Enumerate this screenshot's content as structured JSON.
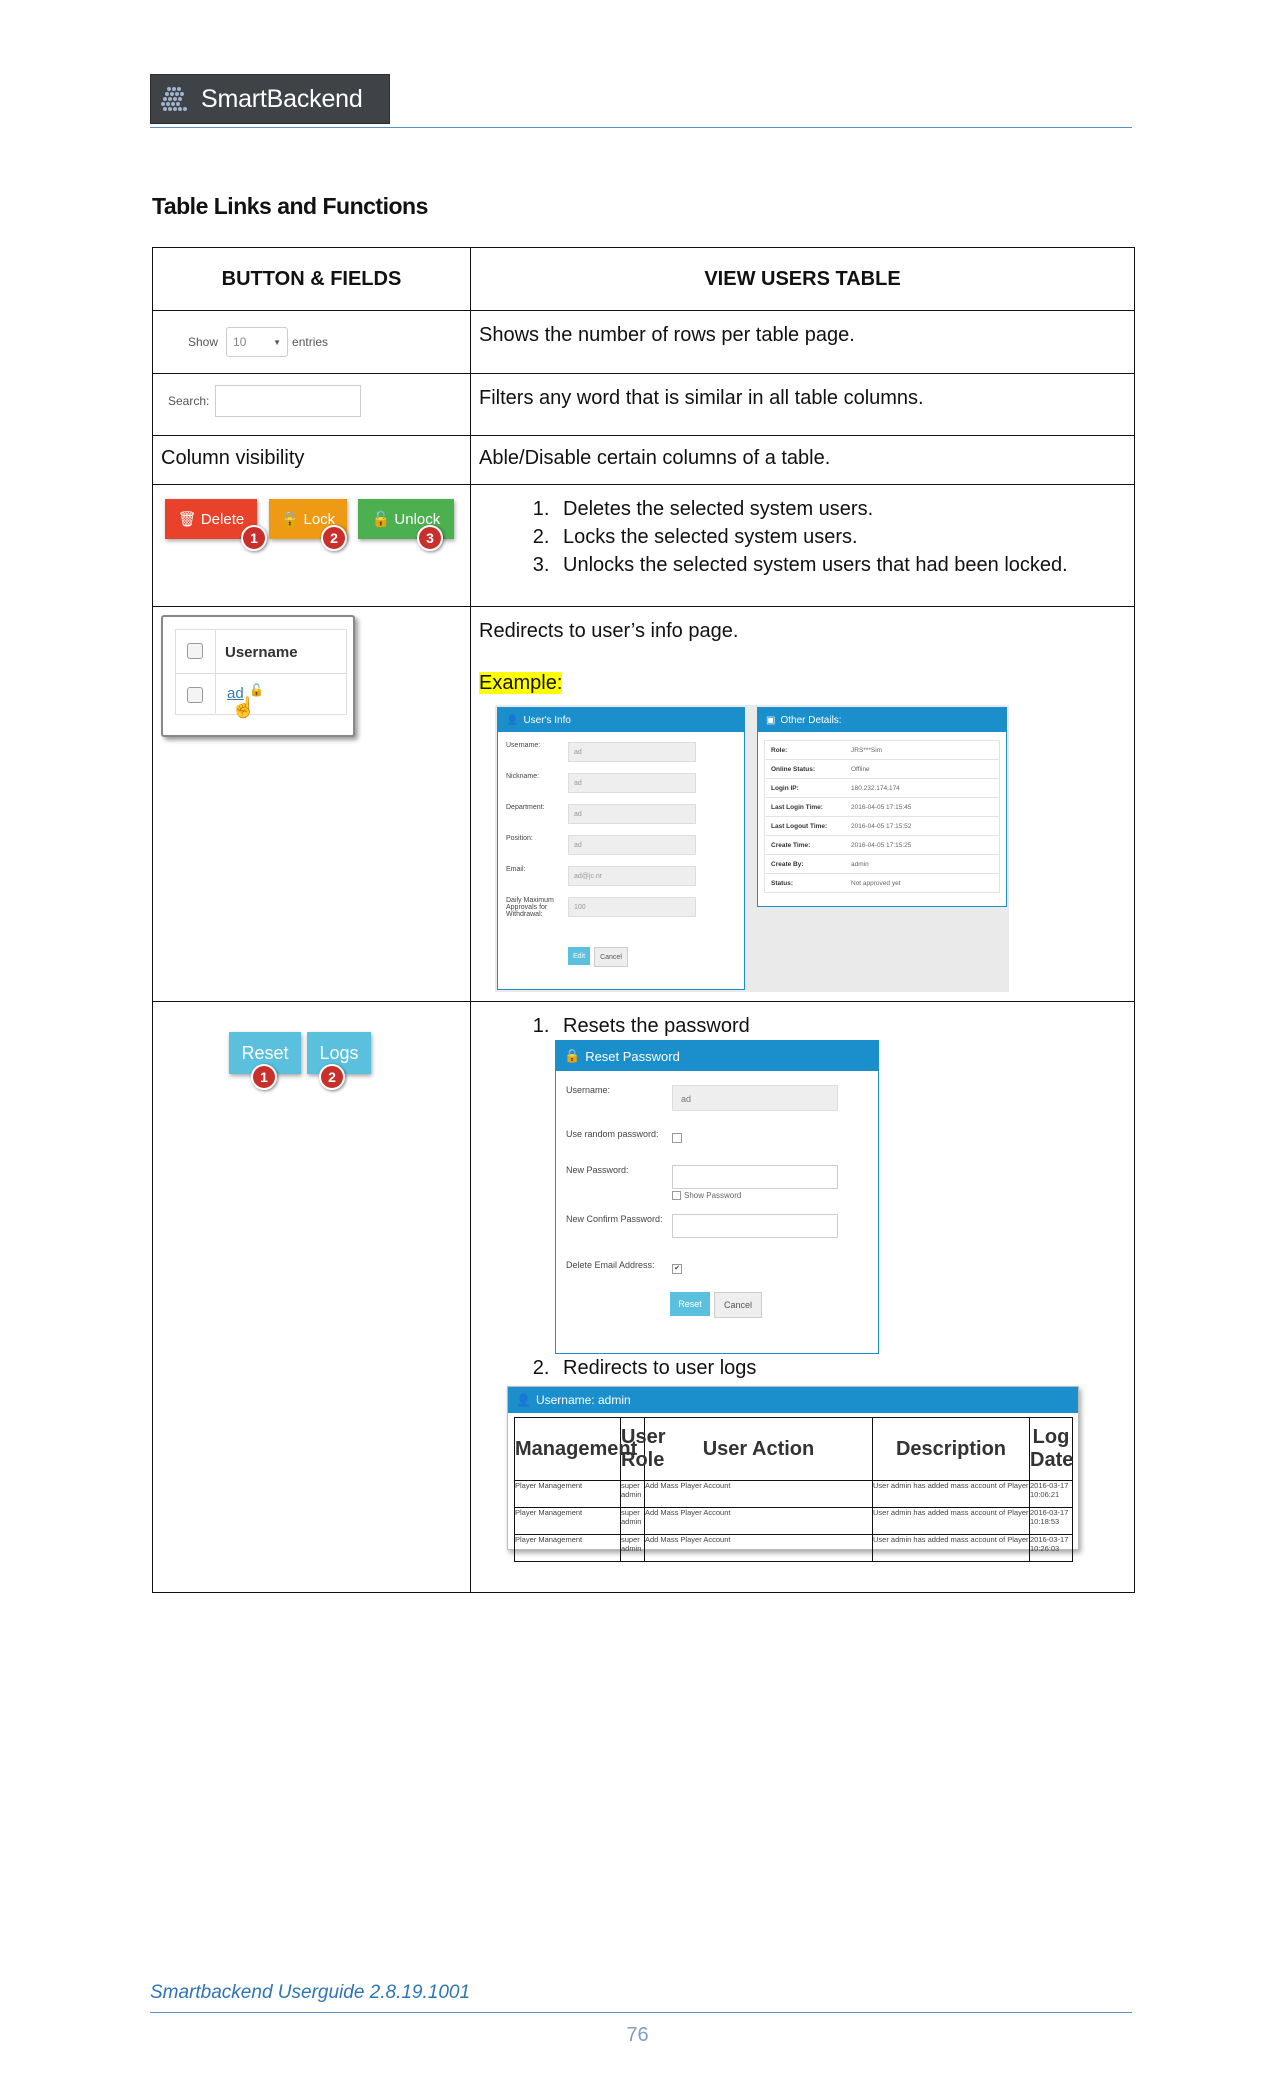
{
  "header": {
    "logo_text": "SmartBackend"
  },
  "section_title": "Table Links and Functions",
  "table": {
    "col1_header": "BUTTON & FIELDS",
    "col2_header": "VIEW USERS TABLE",
    "rows": {
      "show": {
        "widget": {
          "show_label": "Show",
          "select_value": "10",
          "entries_label": "entries"
        },
        "description": "Shows the number of rows per table page."
      },
      "search": {
        "widget": {
          "search_label": "Search:"
        },
        "description": "Filters any word that is similar in all table columns."
      },
      "column_visibility": {
        "label": "Column visibility",
        "description": "Able/Disable certain columns of a table."
      },
      "actions": {
        "buttons": [
          "Delete",
          "Lock",
          "Unlock"
        ],
        "badges": [
          "1",
          "2",
          "3"
        ],
        "items": [
          "Deletes the selected system users.",
          "Locks the selected system users.",
          "Unlocks the selected system users that had been locked."
        ]
      },
      "username": {
        "widget": {
          "header": "Username",
          "link": "ad"
        },
        "description": "Redirects to user’s info page.",
        "example_label": "Example:",
        "users_info": {
          "title": "User's Info",
          "fields": [
            {
              "label": "Username:",
              "value": "ad"
            },
            {
              "label": "Nickname:",
              "value": "ad"
            },
            {
              "label": "Department:",
              "value": "ad"
            },
            {
              "label": "Position:",
              "value": "ad"
            },
            {
              "label": "Email:",
              "value": "ad@jc.nr"
            },
            {
              "label": "Daily Maximum Approvals for Withdrawal:",
              "value": "100"
            }
          ],
          "edit_label": "Edit",
          "cancel_label": "Cancel"
        },
        "other_details": {
          "title": "Other Details:",
          "rows": [
            {
              "key": "Role:",
              "value": "JRS***Sim"
            },
            {
              "key": "Online Status:",
              "value": "Offline"
            },
            {
              "key": "Login IP:",
              "value": "180.232.174.174"
            },
            {
              "key": "Last Login Time:",
              "value": "2016-04-05 17:15:45"
            },
            {
              "key": "Last Logout Time:",
              "value": "2016-04-05 17:15:52"
            },
            {
              "key": "Create Time:",
              "value": "2016-04-05 17:15:25"
            },
            {
              "key": "Create By:",
              "value": "admin"
            },
            {
              "key": "Status:",
              "value": "Not approved yet"
            }
          ]
        }
      },
      "reset_logs": {
        "buttons": [
          "Reset",
          "Logs"
        ],
        "badges": [
          "1",
          "2"
        ],
        "item1": "Resets the password",
        "item2": "Redirects to user logs",
        "reset_password": {
          "title": "Reset Password",
          "username_label": "Username:",
          "username_value": "ad",
          "random_label": "Use random password:",
          "new_label": "New Password:",
          "show_password": "Show Password",
          "confirm_label": "New Confirm Password:",
          "delete_email_label": "Delete Email Address:",
          "reset_btn": "Reset",
          "cancel_btn": "Cancel"
        },
        "logs": {
          "title": "Username: admin",
          "columns": [
            "Management",
            "User Role",
            "User Action",
            "Description",
            "Log Date"
          ],
          "rows": [
            [
              "Player Management",
              "super admin",
              "Add Mass Player Account",
              "User admin has added mass account of Player",
              "2016-03-17 10:06:21"
            ],
            [
              "Player Management",
              "super admin",
              "Add Mass Player Account",
              "User admin has added mass account of Player",
              "2016-03-17 10:18:53"
            ],
            [
              "Player Management",
              "super admin",
              "Add Mass Player Account",
              "User admin has added mass account of Player",
              "2016-03-17 10:26:03"
            ]
          ]
        }
      }
    }
  },
  "footer": {
    "title": "Smartbackend Userguide 2.8.19.1001",
    "page": "76"
  },
  "colors": {
    "delete": "#e8422a",
    "lock": "#ef9a14",
    "unlock": "#4caf50",
    "info": "#5bc0de",
    "panel": "#1b8fcc",
    "rule": "#5b8fc9"
  }
}
